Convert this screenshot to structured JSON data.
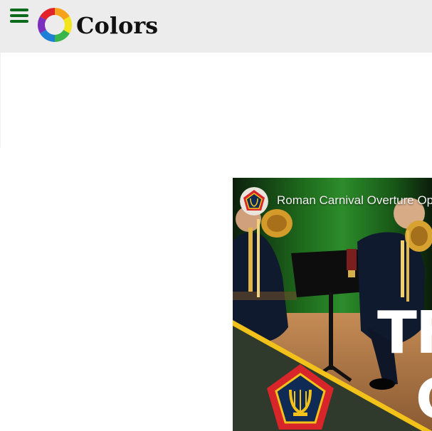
{
  "header": {
    "app_name": "Colors",
    "menu_icon": "hamburger-menu-icon",
    "logo_icon": "color-wheel-icon",
    "menu_color": "#0b6b1a",
    "background": "#ececec"
  },
  "video": {
    "title": "Roman Carnival Overture Op",
    "overlay_line_1": "TF",
    "overlay_line_2": "C",
    "channel_icon": "army-band-emblem-icon",
    "emblem_icon": "lyre-pentagon-emblem-icon",
    "accent_colors": {
      "band_yellow": "#f2c21a",
      "emblem_red": "#d8252a",
      "emblem_navy": "#0f2a55",
      "banner_green": "#2f3a2c"
    }
  }
}
